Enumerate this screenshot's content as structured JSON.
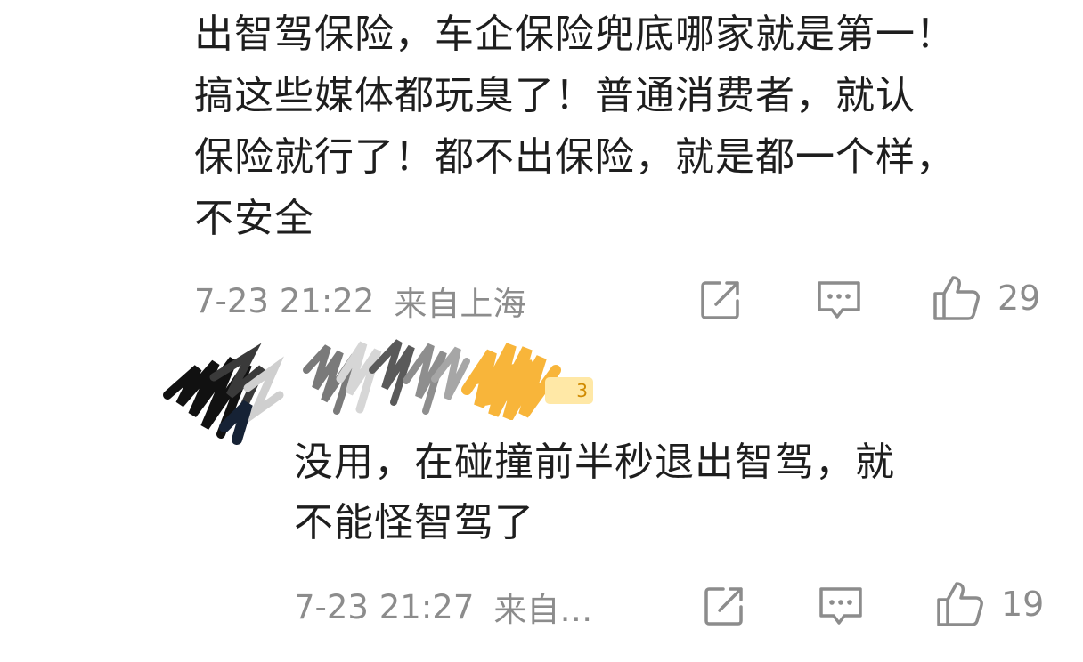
{
  "comment": {
    "lines": [
      "出智驾保险，车企保险兜底哪家就是第一！",
      "搞这些媒体都玩臭了！普通消费者，就认",
      "保险就行了！都不出保险，就是都一个样，",
      "不安全"
    ],
    "time": "7-23 21:22",
    "location": "来自上海",
    "likes": "29",
    "icons": [
      "share-icon",
      "comment-icon",
      "like-icon"
    ]
  },
  "reply": {
    "badge": "3",
    "lines": [
      "没用，在碰撞前半秒退出智驾，就",
      "不能怪智驾了"
    ],
    "time": "7-23 21:27",
    "location": "来自…",
    "likes": "19",
    "icons": [
      "share-icon",
      "comment-icon",
      "like-icon"
    ]
  },
  "colors": {
    "text": "#1e1e1e",
    "meta": "#8c8c8c",
    "badge_bg": "#ffe8a6",
    "badge_text": "#d08a00",
    "blur_orange": "#f8b53a"
  }
}
